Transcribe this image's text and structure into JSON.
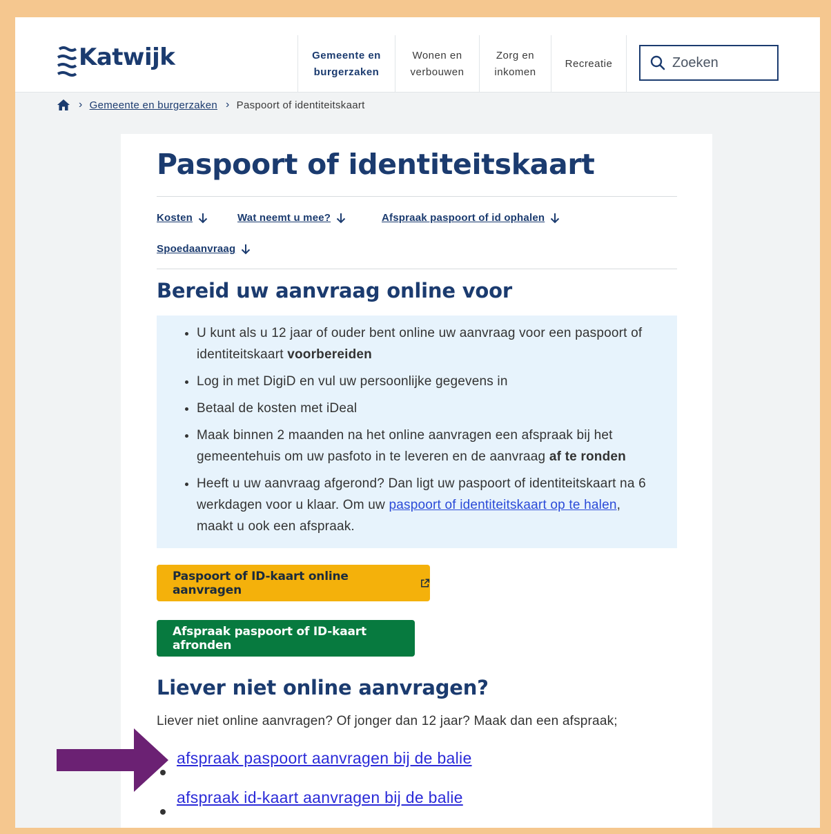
{
  "header": {
    "logo_text": "Katwijk",
    "nav": [
      {
        "line1": "Gemeente en",
        "line2": "burgerzaken",
        "active": true
      },
      {
        "line1": "Wonen en",
        "line2": "verbouwen",
        "active": false
      },
      {
        "line1": "Zorg en",
        "line2": "inkomen",
        "active": false
      },
      {
        "line1": "Recreatie",
        "line2": "",
        "active": false
      }
    ],
    "search_label": "Zoeken"
  },
  "breadcrumb": {
    "home_icon": "home-icon",
    "items": [
      "Gemeente en burgerzaken",
      "Paspoort of identiteitskaart"
    ]
  },
  "page": {
    "title": "Paspoort of identiteitskaart",
    "anchors": [
      "Kosten",
      "Wat neemt u mee?",
      "Afspraak paspoort of id ophalen",
      "Spoedaanvraag"
    ],
    "section1_title": "Bereid uw aanvraag online voor",
    "info_items": {
      "i1_text": "U kunt als u 12 jaar of ouder bent online uw aanvraag voor een paspoort of identiteitskaart ",
      "i1_bold": "voorbereiden",
      "i2_text": "Log in met DigiD en vul uw persoonlijke gegevens in",
      "i3_text": "Betaal de kosten met iDeal",
      "i4_text": "Maak binnen 2 maanden na het online aanvragen een afspraak bij het gemeentehuis om uw pasfoto in te leveren en de aanvraag ",
      "i4_bold": "af te ronden",
      "i5_text": "Heeft u uw aanvraag afgerond? Dan ligt uw paspoort of identiteitskaart na 6 werkdagen voor u klaar. Om uw ",
      "i5_link": "paspoort of identiteitskaart op te halen",
      "i5_tail": ", maakt u ook een afspraak."
    },
    "btn_online": "Paspoort of ID-kaart online aanvragen",
    "btn_online_icon": "external-link-icon",
    "btn_afronden": "Afspraak paspoort of ID-kaart afronden",
    "section2_title": "Liever niet online aanvragen?",
    "section2_text": "Liever niet online aanvragen? Of jonger dan 12 jaar? Maak dan een afspraak;",
    "link_paspoort": "afspraak paspoort aanvragen bij de balie",
    "link_idkaart": "afspraak id-kaart aanvragen bij de balie"
  },
  "colors": {
    "frame": "#f5c78f",
    "brand_blue": "#1b3b6f",
    "yellow_button": "#f4b10b",
    "green_button": "#077a3f",
    "info_bg": "#e7f3fc",
    "annotation_arrow": "#6b2173"
  }
}
